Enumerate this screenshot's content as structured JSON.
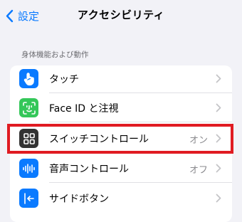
{
  "nav": {
    "back_label": "設定",
    "title": "アクセシビリティ"
  },
  "section": {
    "header": "身体機能および動作"
  },
  "rows": [
    {
      "label": "タッチ",
      "value": "",
      "icon": "hand-touch-icon",
      "icon_color": "#0a7aff"
    },
    {
      "label": "Face ID と注視",
      "value": "",
      "icon": "face-id-icon",
      "icon_color": "#34c759"
    },
    {
      "label": "スイッチコントロール",
      "value": "オン",
      "icon": "switch-control-icon",
      "icon_color": "#333333"
    },
    {
      "label": "音声コントロール",
      "value": "オフ",
      "icon": "voice-control-icon",
      "icon_color": "#0a7aff"
    },
    {
      "label": "サイドボタン",
      "value": "",
      "icon": "side-button-icon",
      "icon_color": "#0a7aff"
    }
  ],
  "highlight": {
    "color": "#e01b22",
    "target": "スイッチコントロール"
  },
  "colors": {
    "accent": "#0a7aff",
    "background": "#f2f2f7"
  }
}
